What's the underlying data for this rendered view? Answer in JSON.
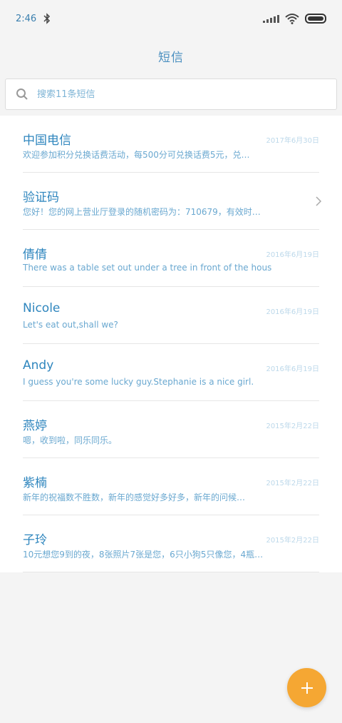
{
  "status_bar": {
    "time": "2:46",
    "icons": [
      "bluetooth-icon",
      "signal-icon",
      "wifi-icon",
      "battery-icon"
    ]
  },
  "header": {
    "title": "短信"
  },
  "search": {
    "placeholder": "搜索11条短信",
    "value": ""
  },
  "conversations": [
    {
      "name": "中国电信",
      "date": "2017年6月30日",
      "preview": "欢迎参加积分兑换话费活动，每500分可兑换话费5元，兑…"
    },
    {
      "name": "验证码",
      "date": "",
      "preview": "您好！您的网上营业厅登录的随机密码为：710679，有效时…",
      "has_chevron": true
    },
    {
      "name": "倩倩",
      "date": "2016年6月19日",
      "preview": "There was a table set out under a tree in front of the hous"
    },
    {
      "name": "Nicole",
      "date": "2016年6月19日",
      "preview": "Let's eat out,shall we?"
    },
    {
      "name": "Andy",
      "date": "2016年6月19日",
      "preview": "I guess you're some lucky guy.Stephanie is a nice girl."
    },
    {
      "name": "燕婷",
      "date": "2015年2月22日",
      "preview": "嗯，收到啦，同乐同乐。"
    },
    {
      "name": "紫楠",
      "date": "2015年2月22日",
      "preview": "新年的祝福数不胜数，新年的感觉好多好多，新年的问候…"
    },
    {
      "name": "子玲",
      "date": "2015年2月22日",
      "preview": "10元想您9到的夜，8张照片7张是您，6只小狗5只像您，4瓶…"
    }
  ],
  "fab": {
    "icon": "plus-icon"
  },
  "colors": {
    "accent": "#2f86be",
    "fab": "#f5a733"
  }
}
